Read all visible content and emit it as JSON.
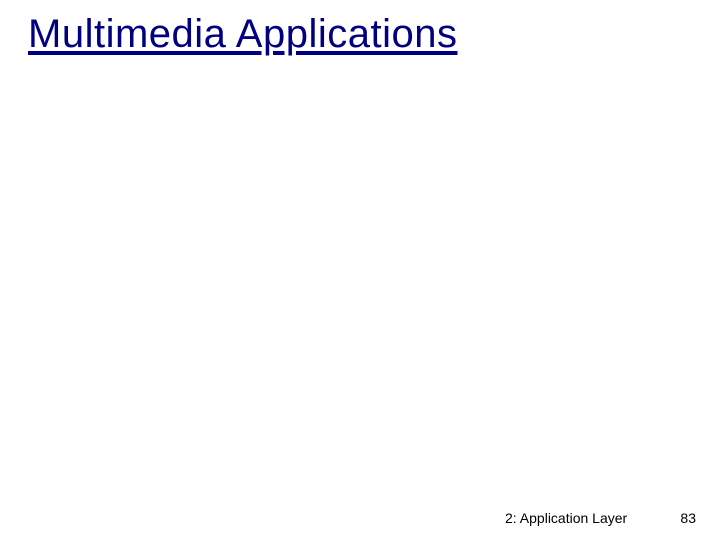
{
  "slide": {
    "title": "Multimedia Applications",
    "footer_section": "2: Application Layer",
    "slide_number": "83"
  }
}
